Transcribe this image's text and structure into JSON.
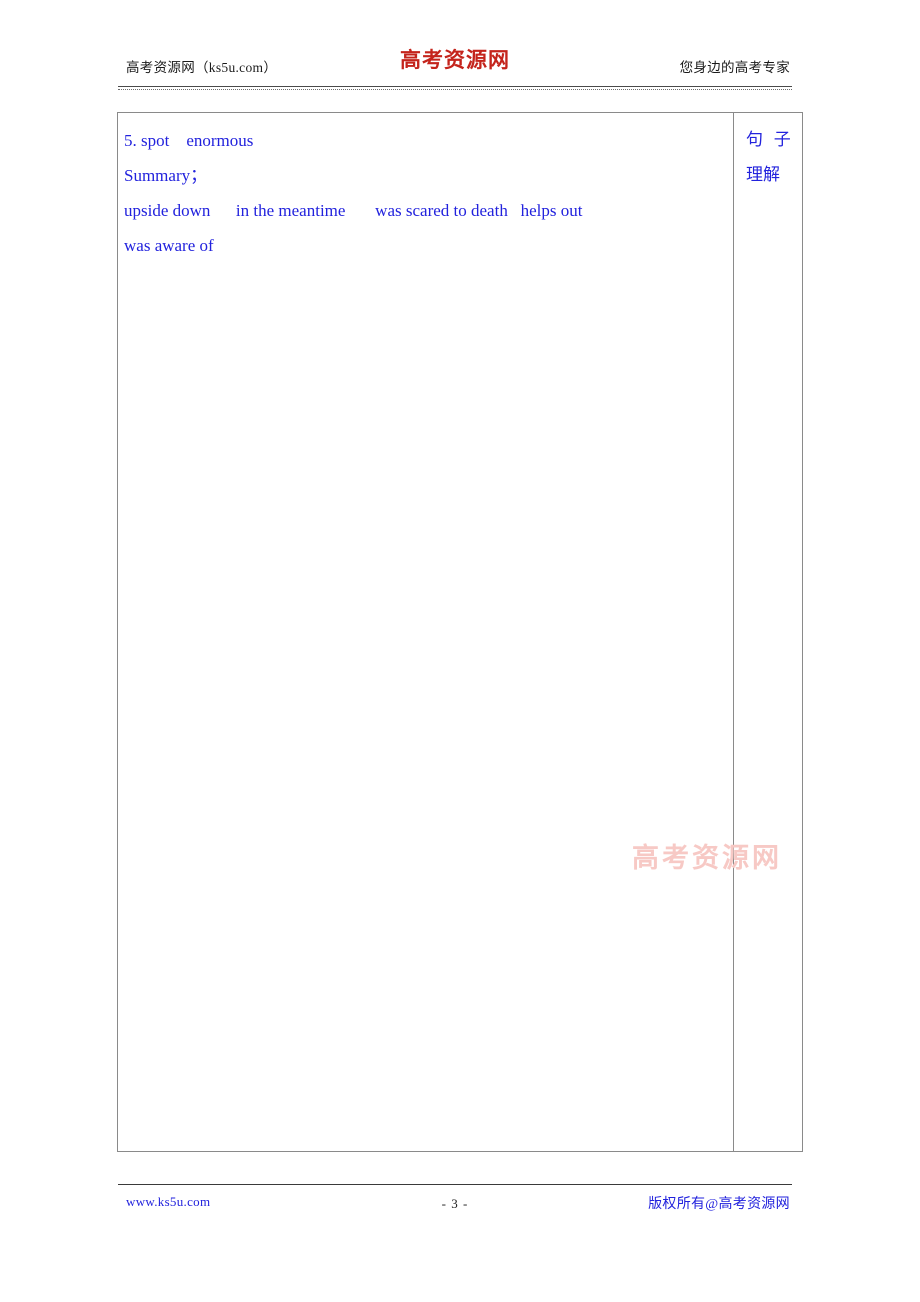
{
  "header": {
    "left_text": "高考资源网（ks5u.com）",
    "logo_text": "高考资源网",
    "right_text": "您身边的高考专家"
  },
  "watermark": {
    "text": "高考资源网"
  },
  "table": {
    "main_column": {
      "lines": [
        "5. spot    enormous",
        "Summary；",
        "upside down      in the meantime       was scared to death   helps out",
        "was aware of"
      ]
    },
    "side_column": {
      "lines": [
        "句  子",
        "理解"
      ]
    }
  },
  "footer": {
    "left_text": "www.ks5u.com",
    "page_number": "- 3 -",
    "right_text": "版权所有@高考资源网"
  },
  "colors": {
    "body_text_blue": "#2222dd",
    "logo_red": "#c4241c",
    "watermark_pink": "#f7c9c5",
    "border_gray": "#8a8a8a"
  }
}
